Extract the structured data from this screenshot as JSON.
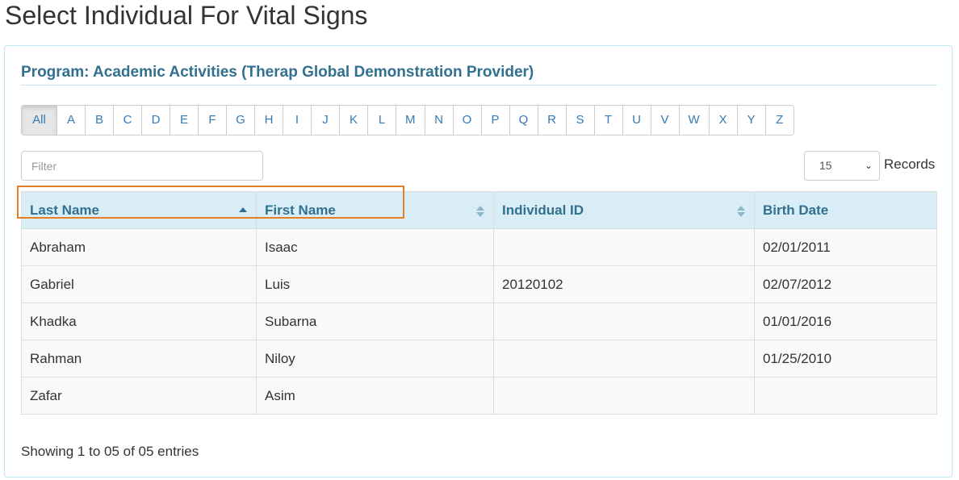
{
  "page": {
    "title": "Select Individual For Vital Signs"
  },
  "panel": {
    "program_heading": "Program: Academic Activities (Therap Global Demonstration Provider)"
  },
  "alphabet": {
    "active": "All",
    "letters": [
      "All",
      "A",
      "B",
      "C",
      "D",
      "E",
      "F",
      "G",
      "H",
      "I",
      "J",
      "K",
      "L",
      "M",
      "N",
      "O",
      "P",
      "Q",
      "R",
      "S",
      "T",
      "U",
      "V",
      "W",
      "X",
      "Y",
      "Z"
    ]
  },
  "filter": {
    "placeholder": "Filter",
    "value": ""
  },
  "records": {
    "selected": "15",
    "label": "Records"
  },
  "table": {
    "columns": [
      {
        "label": "Last Name",
        "sort": "ascending"
      },
      {
        "label": "First Name",
        "sort": "sortable"
      },
      {
        "label": "Individual ID",
        "sort": "sortable"
      },
      {
        "label": "Birth Date",
        "sort": "none"
      }
    ],
    "rows": [
      [
        "Abraham",
        "Isaac",
        "",
        "02/01/2011"
      ],
      [
        "Gabriel",
        "Luis",
        "20120102",
        "02/07/2012"
      ],
      [
        "Khadka",
        "Subarna",
        "",
        "01/01/2016"
      ],
      [
        "Rahman",
        "Niloy",
        "",
        "01/25/2010"
      ],
      [
        "Zafar",
        "Asim",
        "",
        ""
      ]
    ]
  },
  "footer": {
    "showing": "Showing 1 to 05 of 05 entries"
  },
  "colors": {
    "accent": "#31708f",
    "header_bg": "#d9edf7",
    "link": "#337ab7",
    "highlight": "#e67e22"
  }
}
